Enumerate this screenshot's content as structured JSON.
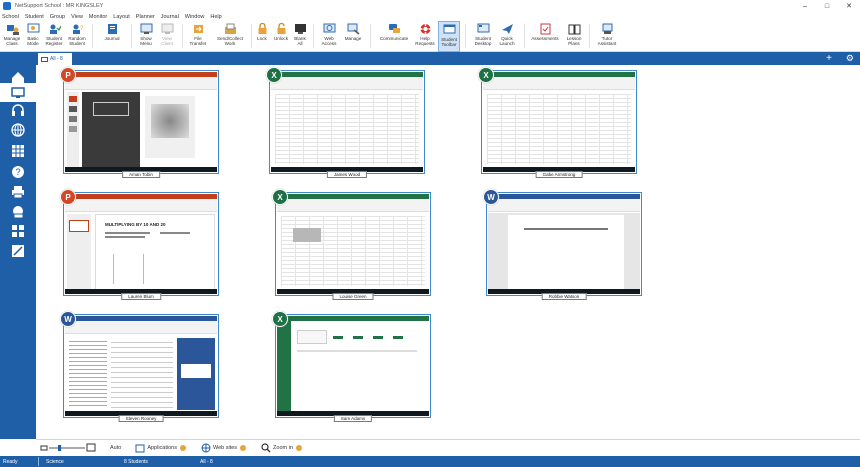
{
  "window": {
    "title": "NetSupport School : MR KINGSLEY",
    "controls": [
      "minimize",
      "maximize",
      "close"
    ]
  },
  "menu": [
    "School",
    "Student",
    "Group",
    "View",
    "Monitor",
    "Layout",
    "Planner",
    "Journal",
    "Window",
    "Help"
  ],
  "ribbon": [
    {
      "id": "manage-class",
      "label": "Manage\nClass",
      "icon": "manage-class-icon"
    },
    {
      "id": "basic-mode",
      "label": "Basic\nMode",
      "icon": "basic-mode-icon"
    },
    {
      "id": "student-register",
      "label": "Student\nRegister",
      "icon": "student-register-icon"
    },
    {
      "id": "random-student",
      "label": "Random\nStudent",
      "icon": "random-student-icon"
    },
    {
      "id": "journal",
      "label": "Journal",
      "icon": "journal-icon"
    },
    {
      "id": "show-menu",
      "label": "Show\nMenu",
      "icon": "show-icon"
    },
    {
      "id": "view-client",
      "label": "View\nClient",
      "icon": "view-icon",
      "disabled": true
    },
    {
      "id": "file-transfer",
      "label": "File\nTransfer",
      "icon": "file-transfer-icon"
    },
    {
      "id": "send-collect-work",
      "label": "Send/Collect\nWork",
      "icon": "send-collect-icon"
    },
    {
      "id": "lock",
      "label": "Lock",
      "icon": "lock-icon"
    },
    {
      "id": "unlock",
      "label": "Unlock",
      "icon": "unlock-icon"
    },
    {
      "id": "blank-all",
      "label": "Blank\nAll",
      "icon": "blank-screen-icon"
    },
    {
      "id": "web-access",
      "label": "Web\nAccess",
      "icon": "web-access-icon"
    },
    {
      "id": "manage",
      "label": "Manage",
      "icon": "manage-icon"
    },
    {
      "id": "communicate",
      "label": "Communicate",
      "icon": "communicate-icon"
    },
    {
      "id": "help-requests",
      "label": "Help\nRequests",
      "icon": "lifebuoy-icon"
    },
    {
      "id": "student-toolbar",
      "label": "Student\nToolbar",
      "icon": "student-toolbar-icon",
      "active": true
    },
    {
      "id": "student-desktop",
      "label": "Student\nDesktop",
      "icon": "student-desktop-icon"
    },
    {
      "id": "quick-launch",
      "label": "Quick\nLaunch",
      "icon": "quick-launch-icon"
    },
    {
      "id": "assessments",
      "label": "Assessments",
      "icon": "assessments-icon"
    },
    {
      "id": "lesson-plans",
      "label": "Lesson\nPlans",
      "icon": "lesson-plans-icon"
    },
    {
      "id": "tutor-assistant",
      "label": "Tutor\nAssistant",
      "icon": "tutor-assistant-icon"
    }
  ],
  "tab": {
    "label": "All - 8"
  },
  "sidebar": [
    {
      "id": "home",
      "icon": "home-icon"
    },
    {
      "id": "monitor",
      "icon": "monitor-icon",
      "active": true
    },
    {
      "id": "audio",
      "icon": "headphones-icon"
    },
    {
      "id": "web",
      "icon": "globe-icon"
    },
    {
      "id": "apps",
      "icon": "apps-icon"
    },
    {
      "id": "questions",
      "icon": "question-icon"
    },
    {
      "id": "print",
      "icon": "printer-icon"
    },
    {
      "id": "devices",
      "icon": "devices-icon"
    },
    {
      "id": "survey",
      "icon": "survey-icon"
    },
    {
      "id": "tests",
      "icon": "test-designer-icon"
    }
  ],
  "students": [
    {
      "name": "Aman Tobin",
      "app": "ppt",
      "badge": "P"
    },
    {
      "name": "James Wood",
      "app": "excel",
      "badge": "X"
    },
    {
      "name": "Gabe Armstrong",
      "app": "excel",
      "badge": "X"
    },
    {
      "name": "Lauren Blum",
      "app": "ppt",
      "badge": "P"
    },
    {
      "name": "Louise Green",
      "app": "excel",
      "badge": "X"
    },
    {
      "name": "Robbie Watson",
      "app": "word",
      "badge": "W"
    },
    {
      "name": "Steven Rooney",
      "app": "word",
      "badge": "W"
    },
    {
      "name": "Sam Adams",
      "app": "excel",
      "badge": "X"
    }
  ],
  "thumb_text": {
    "lauren_heading": "MULTIPLYING BY 10 AND 20"
  },
  "bottom": {
    "auto_label": "Auto",
    "applications_label": "Applications",
    "websites_label": "Web sites",
    "zoom_label": "Zoom in"
  },
  "status": {
    "ready": "Ready",
    "class": "Science",
    "students": "8 Students",
    "view": "All - 8"
  },
  "colors": {
    "accent": "#1f5fa8",
    "excel": "#217346",
    "powerpoint": "#c43e1c",
    "word": "#2b579a"
  }
}
